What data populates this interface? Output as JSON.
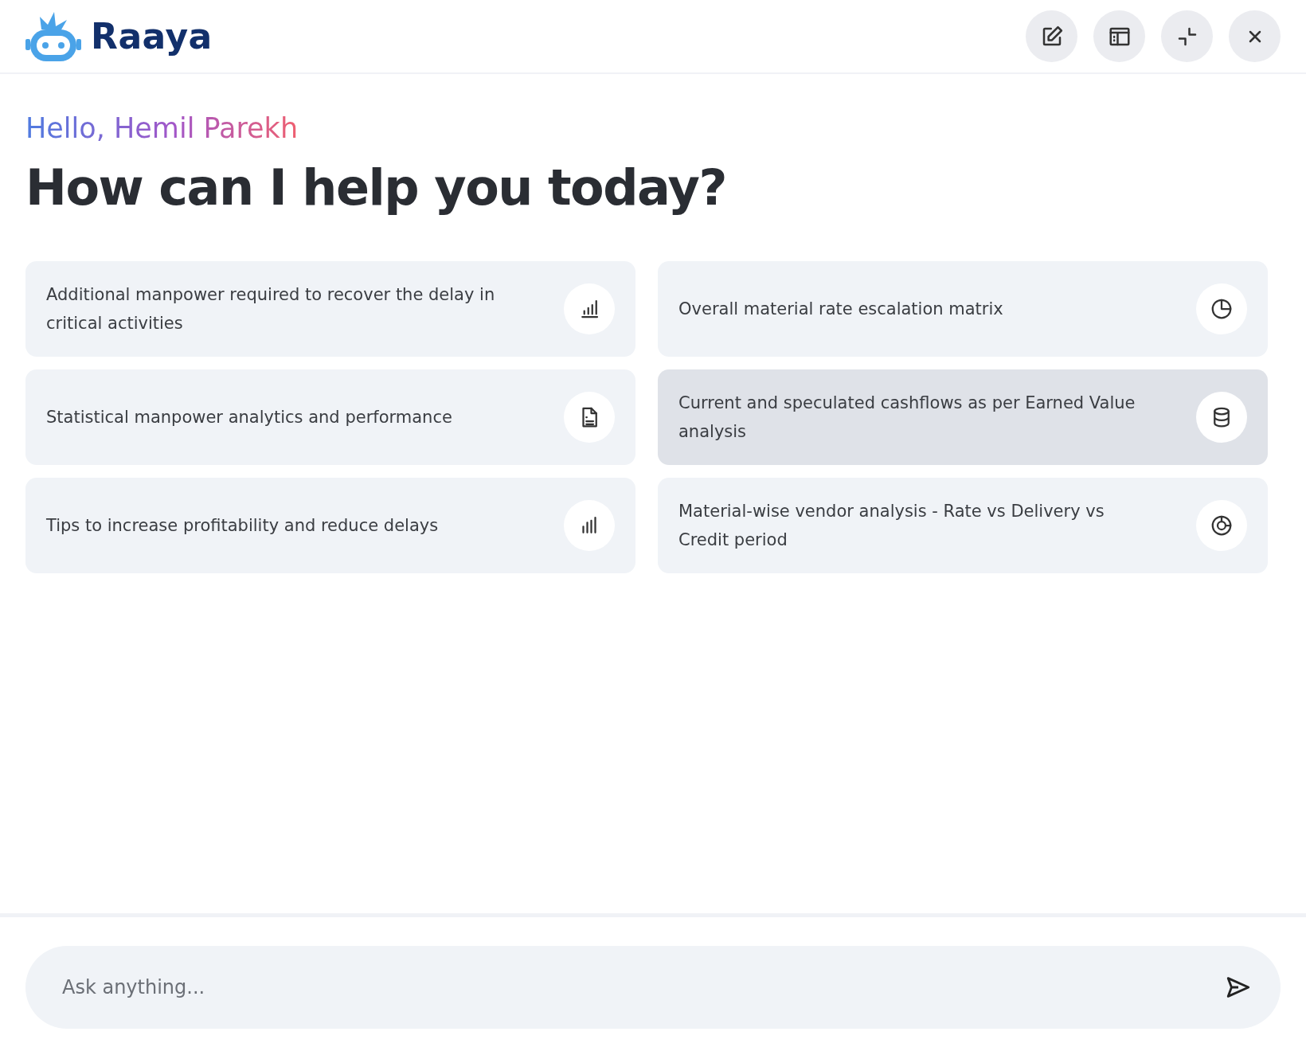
{
  "header": {
    "brand": "Raaya",
    "actions": [
      {
        "kind": "edit"
      },
      {
        "kind": "sidebar"
      },
      {
        "kind": "minimize"
      },
      {
        "kind": "close"
      }
    ]
  },
  "greeting": "Hello, Hemil Parekh",
  "heading": "How can I help you today?",
  "suggestions": [
    {
      "text": "Additional manpower required to recover the delay in critical activities",
      "kind": "chart",
      "selected": false
    },
    {
      "text": "Overall material rate escalation matrix",
      "kind": "pie",
      "selected": false
    },
    {
      "text": "Statistical manpower analytics and performance",
      "kind": "report",
      "selected": false
    },
    {
      "text": "Current and speculated cashflows as per Earned Value analysis",
      "kind": "database",
      "selected": true
    },
    {
      "text": "Tips to increase profitability and reduce delays",
      "kind": "stats",
      "selected": false
    },
    {
      "text": "Material-wise vendor analysis - Rate vs Delivery vs Credit period",
      "kind": "donut",
      "selected": false
    }
  ],
  "composer": {
    "placeholder": "Ask anything..."
  }
}
